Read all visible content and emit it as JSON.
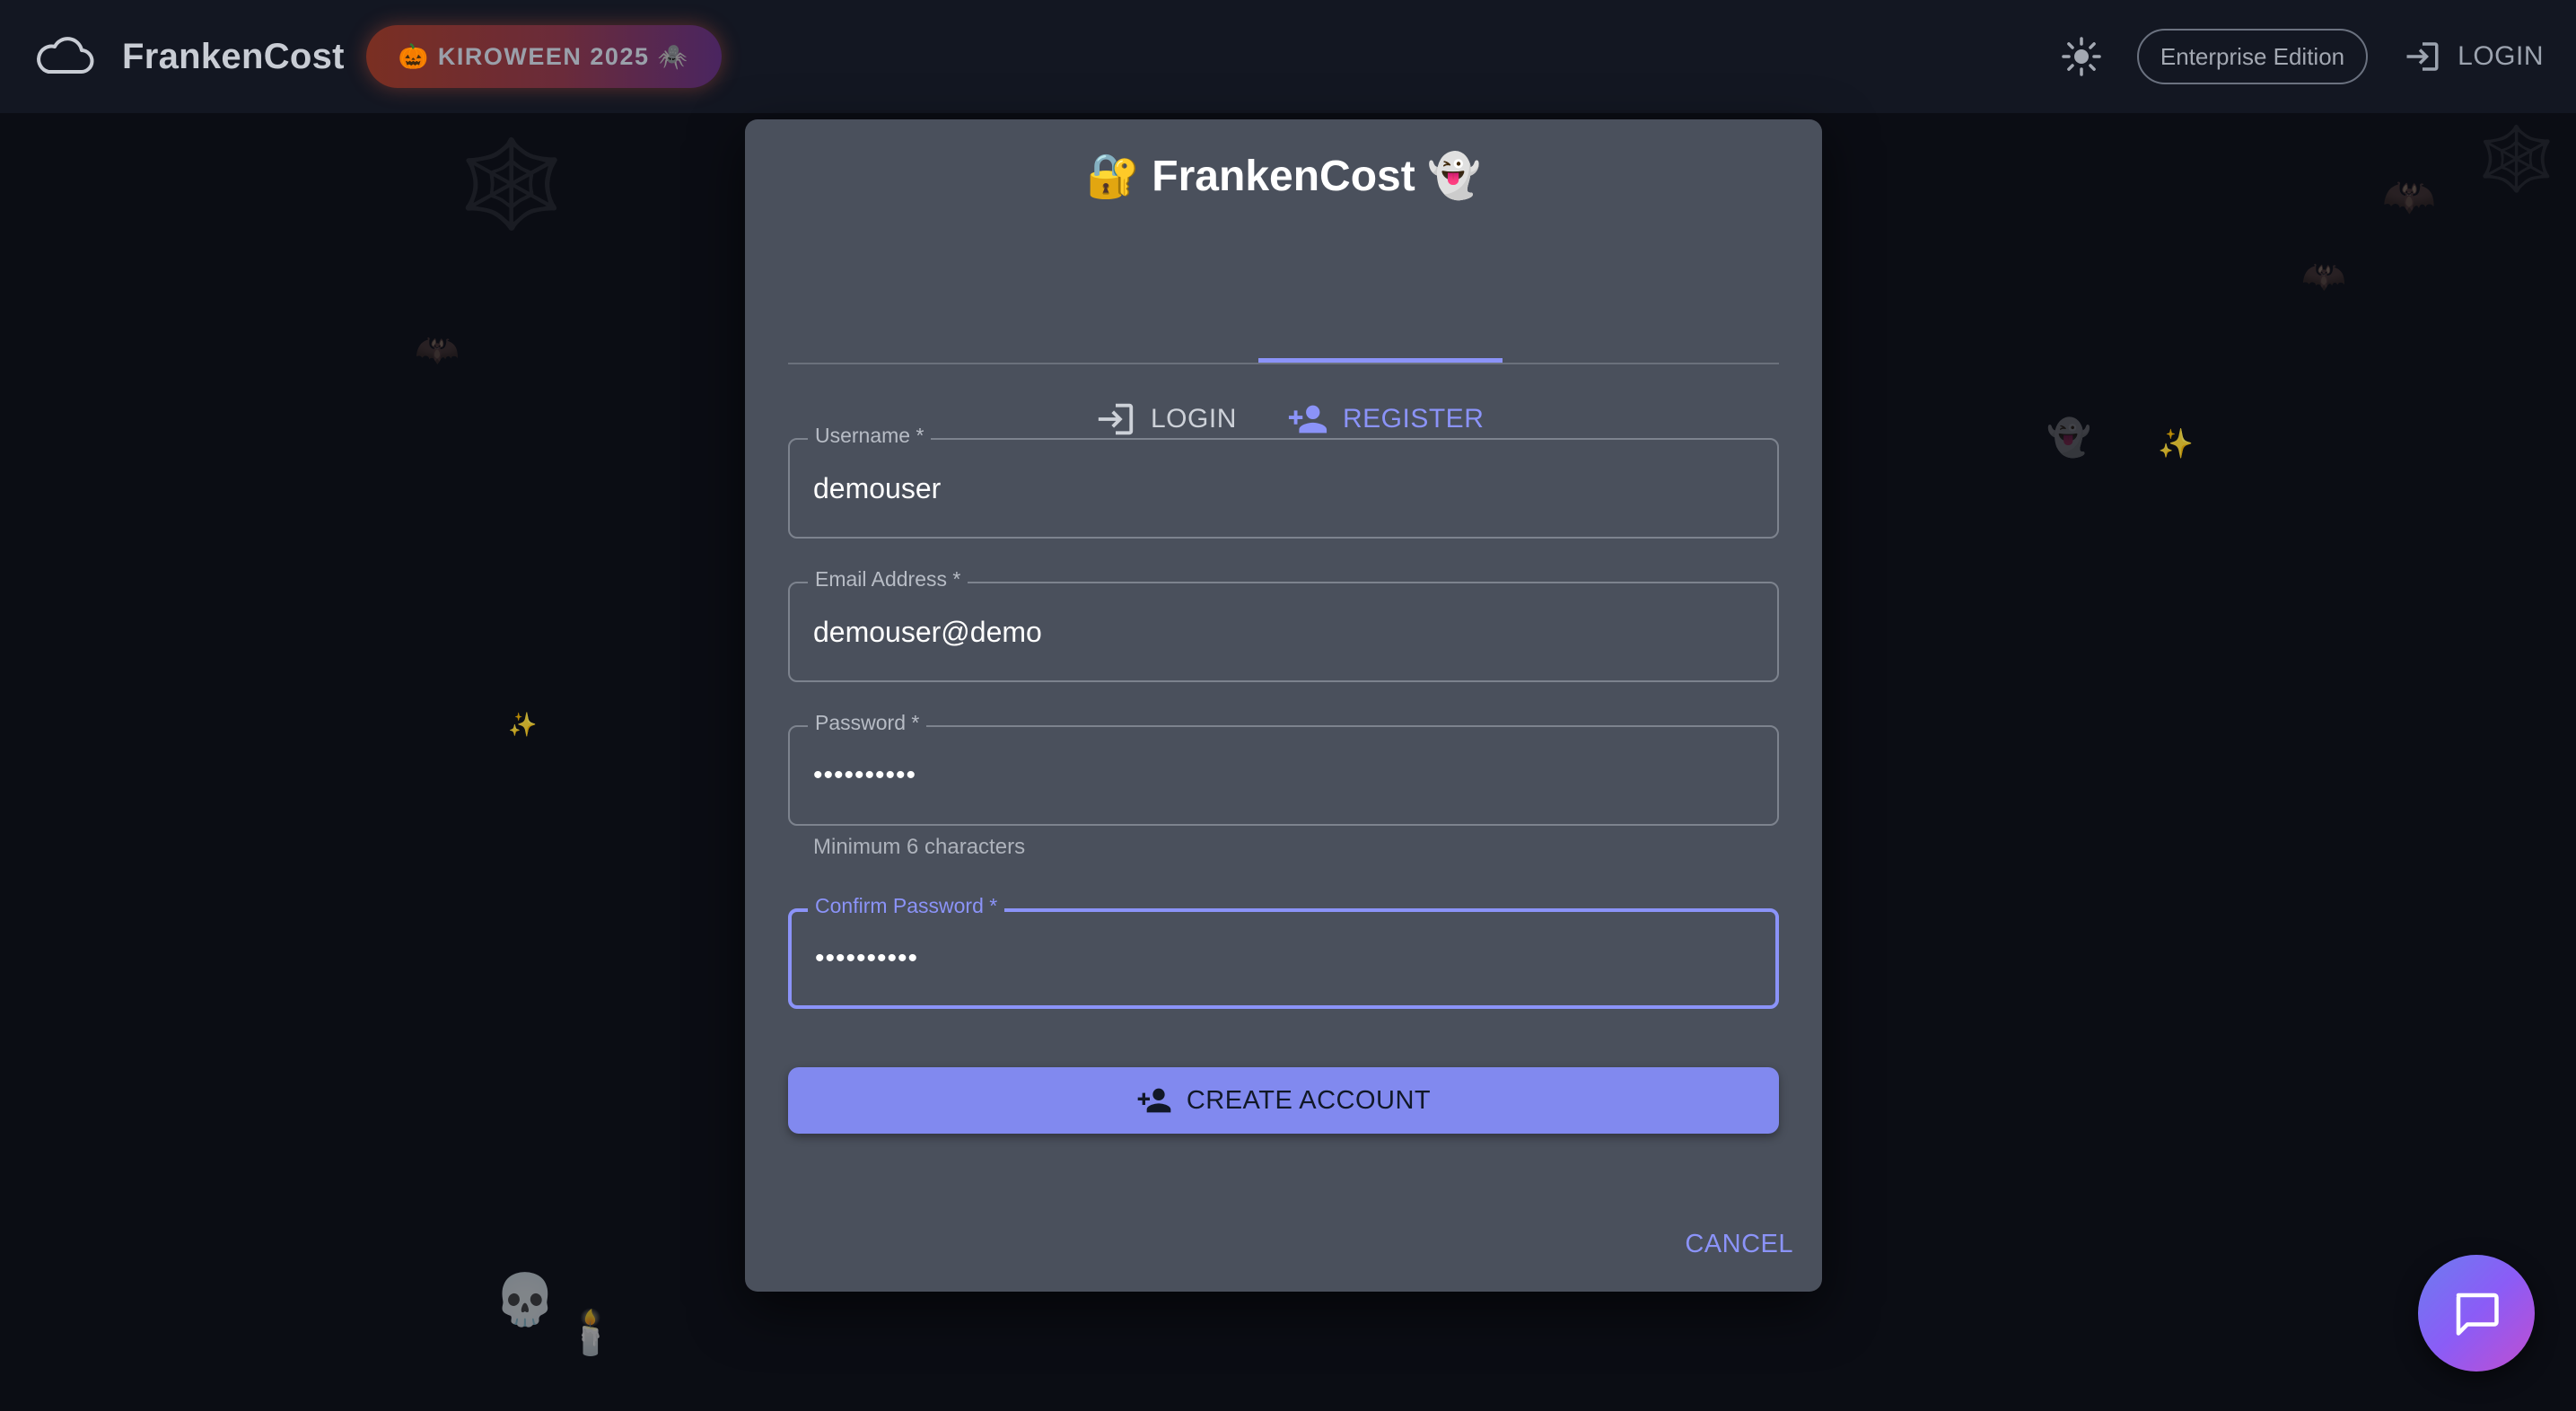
{
  "appbar": {
    "brand_name": "FrankenCost",
    "badge_label": "🎃 KIROWEEN 2025 🕷️",
    "edition_label": "Enterprise Edition",
    "login_label": "LOGIN"
  },
  "decorations": {
    "web": "🕸️",
    "bat": "🦇",
    "sparkle": "✨",
    "ghost": "👻",
    "skull": "💀",
    "candle": "🕯️"
  },
  "dialog": {
    "title": "🔐 FrankenCost 👻",
    "tabs": [
      {
        "label": "LOGIN",
        "icon": "login-icon",
        "active": false
      },
      {
        "label": "REGISTER",
        "icon": "person-add-icon",
        "active": true
      }
    ],
    "fields": {
      "username": {
        "label": "Username",
        "required_mark": "*",
        "value": "demouser"
      },
      "email": {
        "label": "Email Address",
        "required_mark": "*",
        "value": "demouser@demo"
      },
      "password": {
        "label": "Password",
        "required_mark": "*",
        "value": "••••••••••",
        "helper": "Minimum 6 characters"
      },
      "confirm_password": {
        "label": "Confirm Password",
        "required_mark": "*",
        "value": "••••••••••",
        "focused": true
      }
    },
    "create_button_label": "CREATE ACCOUNT",
    "cancel_button_label": "CANCEL"
  },
  "colors": {
    "accent": "#8b93f8",
    "dialog_bg": "#4a505c",
    "page_bg": "#0b0d14",
    "appbar_bg": "#131722"
  },
  "chat_fab": {
    "icon": "chat-icon"
  }
}
